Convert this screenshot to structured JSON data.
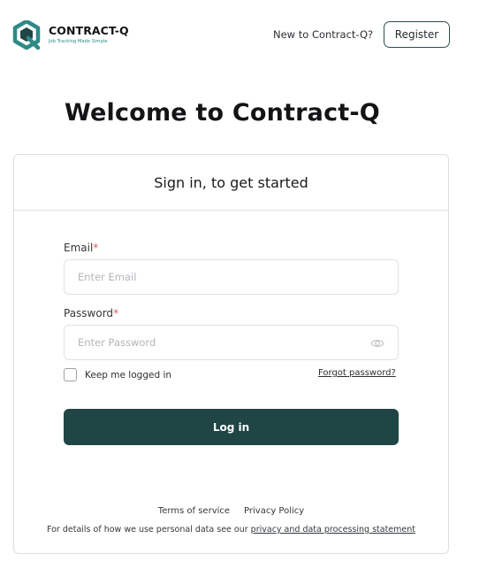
{
  "header": {
    "brand_name": "CONTRACT-Q",
    "brand_tagline": "Job Tracking Made Simple",
    "new_to_text": "New to Contract-Q?",
    "register_label": "Register"
  },
  "welcome_title": "Welcome to Contract-Q",
  "card": {
    "title": "Sign in, to get started",
    "email_label": "Email",
    "email_placeholder": "Enter Email",
    "password_label": "Password",
    "password_placeholder": "Enter Password",
    "required_mark": "*",
    "keep_logged_in_label": "Keep me logged in",
    "forgot_password": "Forgot password?",
    "login_label": "Log in"
  },
  "footer": {
    "terms": "Terms of service",
    "privacy": "Privacy Policy",
    "note_prefix": "For details of how we use personal data see our ",
    "note_link": "privacy and data processing statement"
  },
  "colors": {
    "brand_teal": "#2d8a86",
    "button_dark": "#1f4544",
    "required_red": "#e05b5b"
  },
  "icons": [
    "contract-q-logo",
    "eye-icon"
  ]
}
